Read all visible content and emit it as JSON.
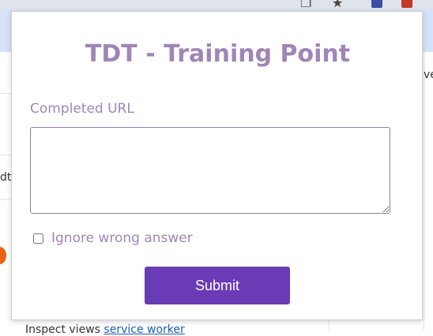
{
  "popup": {
    "title": "TDT - Training Point",
    "url_label": "Completed URL",
    "url_value": "",
    "ignore_label": "Ignore wrong answer",
    "ignore_checked": false,
    "submit_label": "Submit"
  },
  "background": {
    "right_fragment": "ve",
    "left_fragment": "dtu",
    "inspect_prefix": "Inspect views",
    "inspect_link": "service worker"
  },
  "colors": {
    "accent_text": "#9f86b6",
    "submit_bg": "#6a3bb5",
    "chrome_bar": "#d6e2f8"
  }
}
